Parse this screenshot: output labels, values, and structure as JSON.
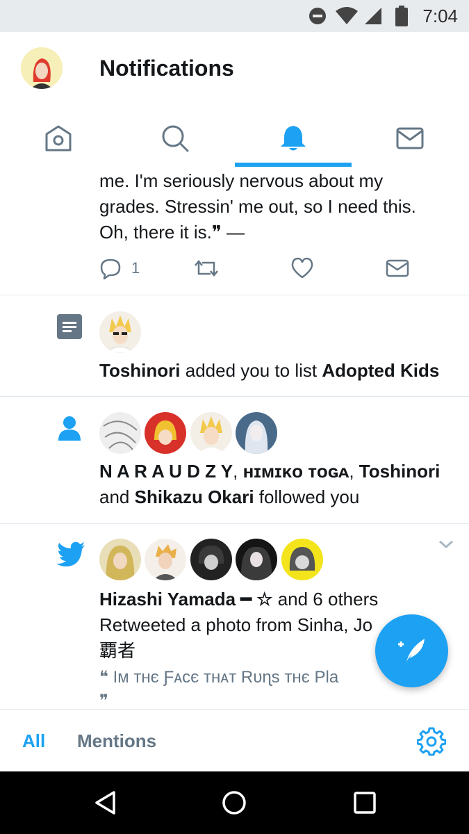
{
  "status_bar": {
    "time": "7:04"
  },
  "header": {
    "title": "Notifications"
  },
  "tabs": [
    {
      "name": "home",
      "icon": "home-icon"
    },
    {
      "name": "search",
      "icon": "search-icon"
    },
    {
      "name": "notifications",
      "icon": "bell-icon",
      "active": true
    },
    {
      "name": "messages",
      "icon": "mail-icon"
    }
  ],
  "tweet_fragment": {
    "line1": "me. I'm seriously nervous about my",
    "line2": "grades. Stressin' me out, so I need this.",
    "line3": "Oh, there it is.❞ —",
    "reply_count": "1"
  },
  "list_notification": {
    "actor": "Toshinori",
    "text": " added you to list ",
    "list_name": "Adopted Kids"
  },
  "follow_notification": {
    "name1": "N A R A U D Z Y",
    "sep1": ", ",
    "name2": "ʜɪᴍɪᴋᴏ ᴛᴏɢᴀ",
    "sep2": ", ",
    "name3": "Toshinori",
    "and": "and ",
    "name4": "Shikazu Okari",
    "text": " followed you"
  },
  "retweet_notification": {
    "actor": "Hizashi Yamada ━ ☆",
    "others": " and 6 others",
    "line2": "Retweeted a photo from Sinha, Jo",
    "line3": "覇者",
    "quote": "❝ Iᴍ ᴛʜє Ƒᴀcє ᴛʜᴀᴛ Rᴜɳs ᴛʜє Pla",
    "quote_end": "❞"
  },
  "bottom_tabs": {
    "all": "All",
    "mentions": "Mentions"
  },
  "colors": {
    "accent": "#1da1f2",
    "muted": "#657786",
    "text": "#14171a"
  }
}
